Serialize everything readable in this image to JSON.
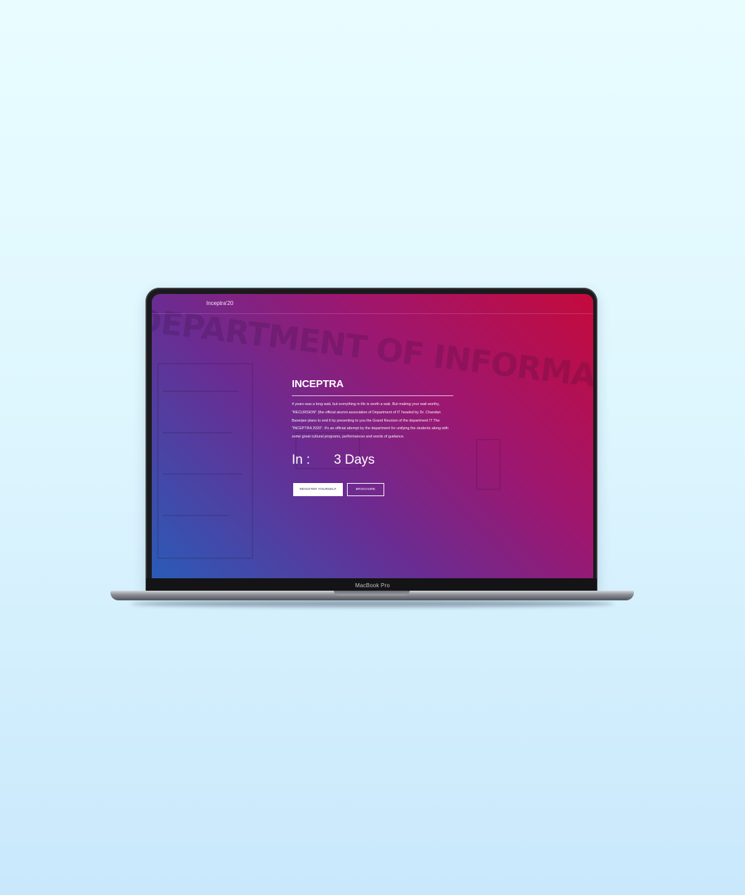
{
  "device": {
    "label": "MacBook Pro"
  },
  "site": {
    "nav": {
      "brand": "Inceptra'20"
    },
    "background_photo": {
      "banner_text": "DEPARTMENT OF INFORMATION TECHNOLOGY"
    },
    "hero": {
      "title": "INCEPTRA",
      "description": "4 years was a long wait, but everything in life is worth a wait. But making your wait worthy, \"RECURSION\" (the official alumni association of Department of IT headed by Dr. Chandan Banerjee plans to end it by presenting to you the Grand Reunion of the department IT The \"INCEPTRA 2020\". It's an official attempt by the department for unifying the students along with some great cultural programs, performances and words of guidance.",
      "countdown": {
        "label": "In :",
        "value": "3 Days"
      },
      "buttons": {
        "register": "REGISTER YOURSELF",
        "brochure": "BROCHURE"
      }
    }
  },
  "colors": {
    "page_top": "#e9fdff",
    "page_bottom": "#c9e8fc",
    "gradient_red": "#c40a3c",
    "gradient_purple": "#6a2c92",
    "gradient_blue": "#2a5bb7"
  }
}
